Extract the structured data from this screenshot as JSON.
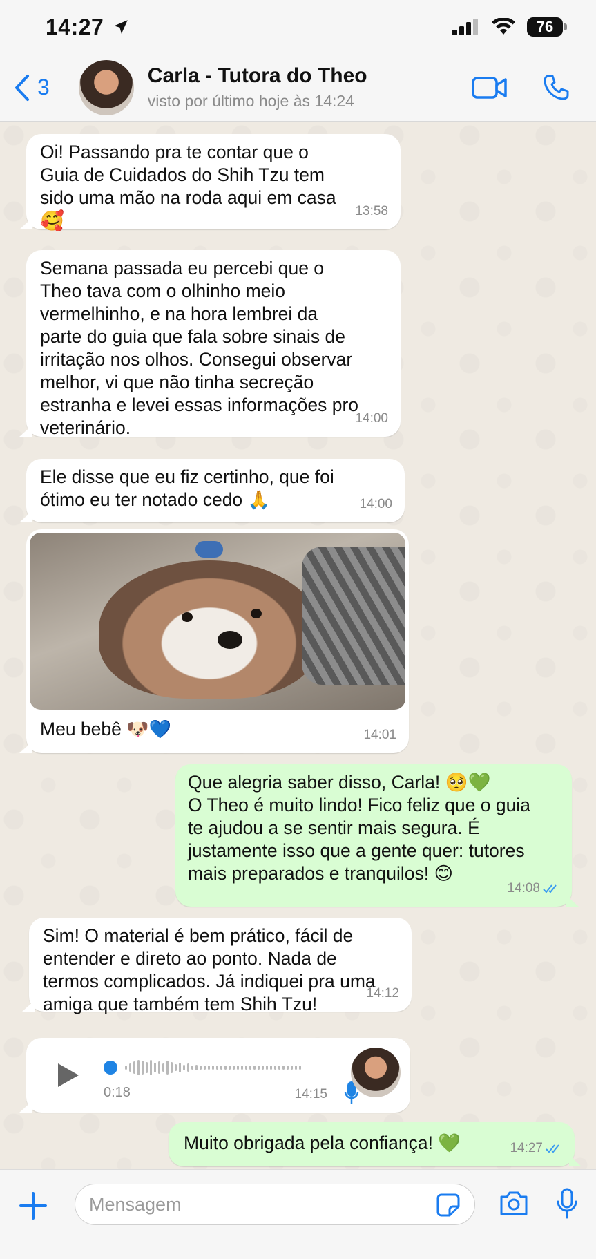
{
  "status_bar": {
    "time": "14:27",
    "battery": "76"
  },
  "header": {
    "back_count": "3",
    "contact_name": "Carla - Tutora do Theo",
    "contact_status": "visto por último hoje às 14:24"
  },
  "messages": [
    {
      "text": "Oi! Passando pra te contar que o\nGuia de Cuidados do Shih Tzu tem\nsido uma mão na roda aqui em casa",
      "emoji": "🥰",
      "time": "13:58"
    },
    {
      "text": "Semana passada eu percebi que o\nTheo tava com o olhinho meio\nvermelhinho, e na hora lembrei da\nparte do guia que fala sobre sinais de\nirritação nos olhos. Consegui observar\nmelhor, vi que não tinha secreção\nestranha e levei essas informações pro\nveterinário.",
      "time": "14:00"
    },
    {
      "text": "Ele disse que eu fiz certinho, que foi\nótimo eu ter notado cedo",
      "emoji": "🙏",
      "time": "14:00"
    },
    {
      "caption": "Meu bebê",
      "emoji": "🐶💙",
      "time": "14:01"
    },
    {
      "text": "Que alegria saber disso, Carla! 🥺💚\nO Theo é muito lindo! Fico feliz que o guia\nte ajudou a se sentir mais segura. É\njustamente isso que a gente quer: tutores\nmais preparados e tranquilos! 😊",
      "time": "14:08"
    },
    {
      "text": "Sim! O material é bem prático, fácil de\nentender e direto ao ponto. Nada de\ntermos complicados. Já indiquei pra uma\namiga que também tem Shih Tzu!",
      "time": "14:12"
    },
    {
      "duration": "0:18",
      "time": "14:15"
    },
    {
      "text": "Muito obrigada pela confiança! 💚",
      "time": "14:27"
    }
  ],
  "input": {
    "placeholder": "Mensagem"
  },
  "colors": {
    "accent": "#1a7cf0",
    "outgoing_bubble": "#d9fdd3",
    "incoming_bubble": "#ffffff",
    "chat_bg": "#efeae2"
  }
}
